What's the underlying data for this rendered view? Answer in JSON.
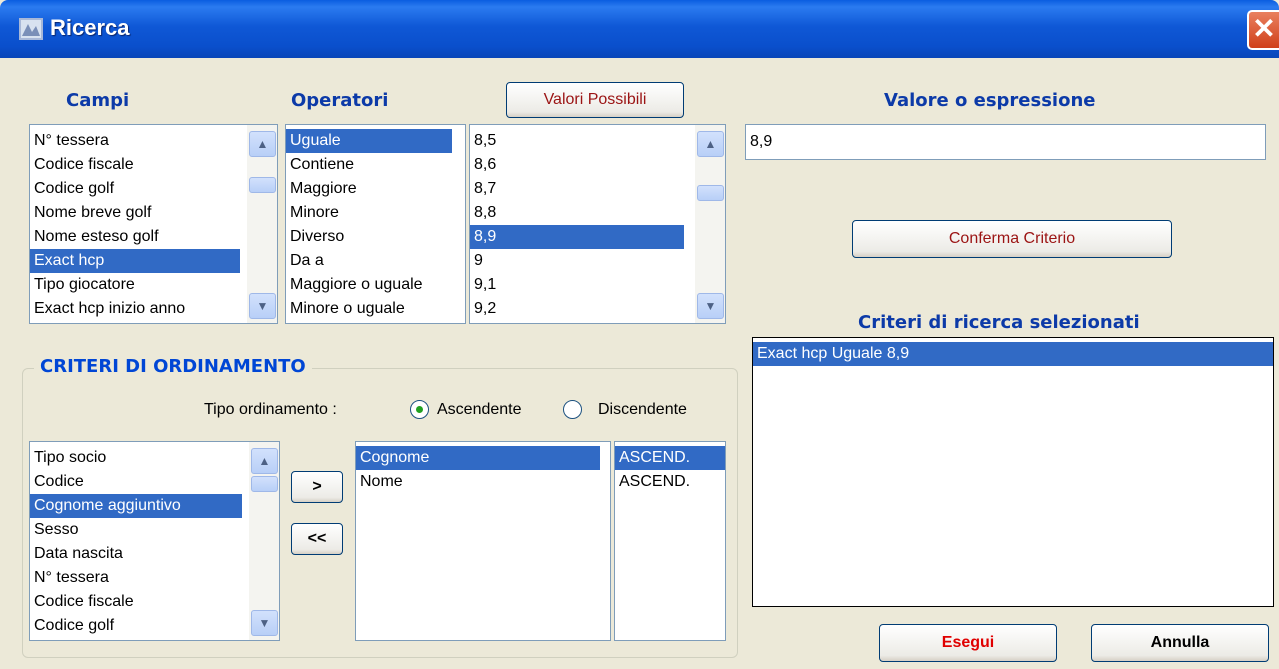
{
  "window": {
    "title": "Ricerca",
    "close_label": "✕"
  },
  "campi": {
    "header": "Campi",
    "items": [
      "N° tessera",
      "Codice fiscale",
      "Codice golf",
      "Nome breve golf",
      "Nome esteso golf",
      "Exact hcp",
      "Tipo giocatore",
      "Exact hcp inizio anno"
    ],
    "selected": "Exact hcp"
  },
  "operatori": {
    "header": "Operatori",
    "items": [
      "Uguale",
      "Contiene",
      "Maggiore",
      "Minore",
      "Diverso",
      "Da a",
      "Maggiore o uguale",
      "Minore o uguale"
    ],
    "selected": "Uguale"
  },
  "valori": {
    "button_label": "Valori Possibili",
    "items": [
      "8,5",
      "8,6",
      "8,7",
      "8,8",
      "8,9",
      "9",
      "9,1",
      "9,2"
    ],
    "selected": "8,9"
  },
  "valore": {
    "header": "Valore o espressione",
    "value": "8,9"
  },
  "conferma_label": "Conferma Criterio",
  "criteri_selezionati": {
    "header": "Criteri di ricerca selezionati",
    "items": [
      "Exact hcp Uguale 8,9"
    ]
  },
  "ordinamento": {
    "title": "CRITERI DI ORDINAMENTO",
    "tipo_label": "Tipo ordinamento :",
    "ascendente_label": "Ascendente",
    "discendente_label": "Discendente",
    "selected_mode": "Ascendente",
    "available": [
      "Tipo socio",
      "Codice",
      "Cognome aggiuntivo",
      "Sesso",
      "Data nascita",
      "N° tessera",
      "Codice fiscale",
      "Codice golf"
    ],
    "available_selected": "Cognome aggiuntivo",
    "add_label": ">",
    "remove_label": "<<",
    "chosen": [
      "Cognome",
      "Nome"
    ],
    "chosen_selected": "Cognome",
    "directions": [
      "ASCEND.",
      "ASCEND."
    ]
  },
  "esegui_label": "Esegui",
  "annulla_label": "Annulla",
  "colors": {
    "accent": "#0c3aa8",
    "selection": "#316ac5",
    "esegui": "#e00000"
  },
  "icons": {
    "scroll_up": "▲",
    "scroll_down": "▼"
  }
}
